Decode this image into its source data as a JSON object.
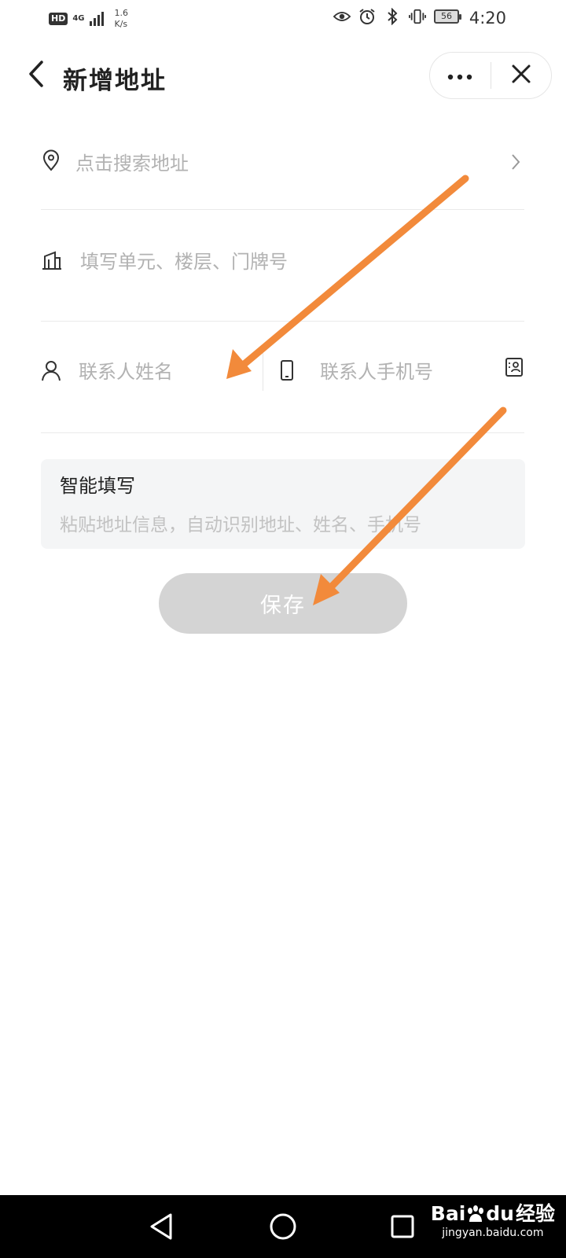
{
  "status_bar": {
    "hd": "HD",
    "network": "4G",
    "speed_value": "1.6",
    "speed_unit": "K/s",
    "battery": "56",
    "time": "4:20"
  },
  "header": {
    "title": "新增地址"
  },
  "form": {
    "search_address_placeholder": "点击搜索地址",
    "unit_placeholder": "填写单元、楼层、门牌号",
    "name_placeholder": "联系人姓名",
    "phone_placeholder": "联系人手机号"
  },
  "smart_fill": {
    "title": "智能填写",
    "placeholder": "粘贴地址信息，自动识别地址、姓名、手机号"
  },
  "save_button": {
    "label": "保存"
  },
  "annotation": {
    "color": "#f28a3b"
  },
  "watermark": {
    "brand_a": "Bai",
    "brand_b": "du",
    "brand_c": "经验",
    "site": "jingyan.baidu.com"
  },
  "icons": [
    "back-arrow-icon",
    "more-icon",
    "close-icon",
    "location-pin-icon",
    "chevron-right-icon",
    "building-icon",
    "person-icon",
    "phone-icon",
    "contact-book-icon",
    "eye-icon",
    "alarm-icon",
    "bluetooth-icon",
    "vibrate-icon",
    "nav-back-icon",
    "nav-home-icon",
    "nav-recent-icon"
  ]
}
